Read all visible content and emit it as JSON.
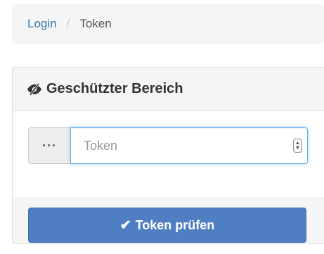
{
  "breadcrumb": {
    "items": [
      {
        "label": "Login",
        "active": false
      },
      {
        "label": "Token",
        "active": true
      }
    ],
    "separator": "/"
  },
  "panel": {
    "title": "Geschützter Bereich",
    "title_icon": "eye-slash-icon"
  },
  "token_field": {
    "addon_label": "···",
    "placeholder": "Token",
    "value": ""
  },
  "submit": {
    "label": "Token prüfen",
    "icon": "check-icon",
    "color": "#4f7fc2"
  },
  "colors": {
    "link": "#337ab7",
    "panel_heading_bg": "#f5f5f5",
    "focus_border": "#66afe9"
  }
}
